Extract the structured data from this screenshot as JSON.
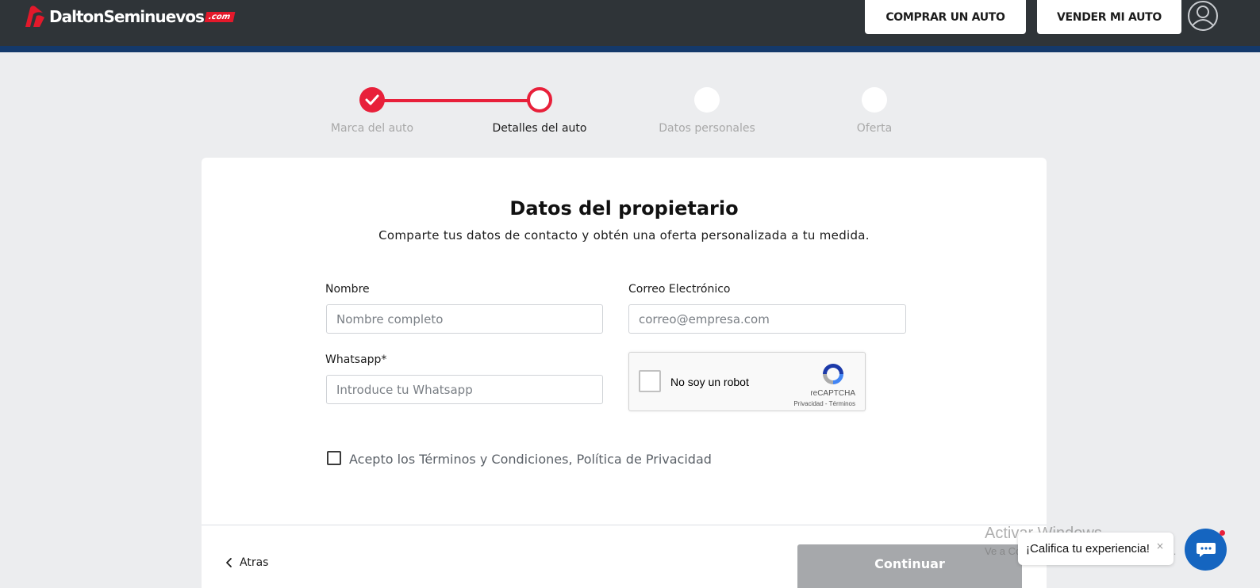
{
  "header": {
    "logo_text": "DaltonSeminuevos",
    "logo_suffix": ".com",
    "nav": {
      "buy_label": "COMPRAR UN AUTO",
      "sell_label": "VENDER MI AUTO"
    }
  },
  "stepper": {
    "steps": [
      {
        "label": "Marca del auto",
        "state": "done"
      },
      {
        "label": "Detalles del auto",
        "state": "active"
      },
      {
        "label": "Datos personales",
        "state": "pending"
      },
      {
        "label": "Oferta",
        "state": "pending"
      }
    ]
  },
  "form": {
    "title": "Datos del propietario",
    "subtitle": "Comparte tus datos de contacto y obtén una oferta personalizada a tu medida.",
    "name": {
      "label": "Nombre",
      "placeholder": "Nombre completo",
      "value": ""
    },
    "email": {
      "label": "Correo Electrónico",
      "placeholder": "correo@empresa.com",
      "value": ""
    },
    "whatsapp": {
      "label": "Whatsapp*",
      "placeholder": "Introduce tu Whatsapp",
      "value": ""
    },
    "recaptcha": {
      "label": "No soy un robot",
      "brand": "reCAPTCHA",
      "links": "Privacidad - Términos",
      "checked": false
    },
    "terms": {
      "label": "Acepto los Términos y Condiciones, Política de Privacidad",
      "checked": false
    },
    "back_label": "Atras",
    "continue_label": "Continuar"
  },
  "watermark": {
    "title": "Activar Windows",
    "subtitle": "Ve a Configuración para activar Windows."
  },
  "feedback": {
    "text": "¡Califica tu experiencia!",
    "close": "×"
  },
  "colors": {
    "accent": "#e8203a",
    "header_bg": "#2f3438",
    "header_stripe": "#14396b",
    "chat": "#1565c0",
    "continue_disabled": "#a6a8ab"
  }
}
